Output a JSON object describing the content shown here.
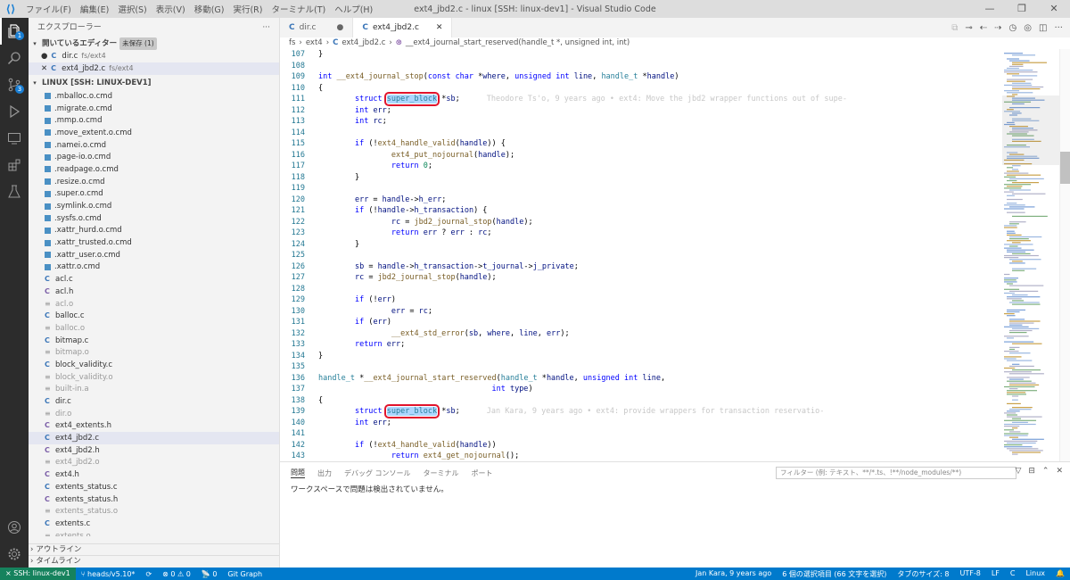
{
  "window": {
    "title": "ext4_jbd2.c - linux [SSH: linux-dev1] - Visual Studio Code",
    "menu": [
      "ファイル(F)",
      "編集(E)",
      "選択(S)",
      "表示(V)",
      "移動(G)",
      "実行(R)",
      "ターミナル(T)",
      "ヘルプ(H)"
    ],
    "controls": [
      "—",
      "❐",
      "✕"
    ]
  },
  "activity": {
    "explorer_badge": "1",
    "scm_badge": "3"
  },
  "sidebar": {
    "title": "エクスプローラー",
    "more": "···",
    "open_editors": {
      "label": "開いているエディター",
      "tag": "未保存 (1)"
    },
    "open_files": [
      {
        "mark": "●",
        "name": "dir.c",
        "path": "fs/ext4"
      },
      {
        "mark": "✕",
        "name": "ext4_jbd2.c",
        "path": "fs/ext4"
      }
    ],
    "workspace": "LINUX [SSH: LINUX-DEV1]",
    "files": [
      {
        "name": ".mballoc.o.cmd",
        "kind": "cmd"
      },
      {
        "name": ".migrate.o.cmd",
        "kind": "cmd"
      },
      {
        "name": ".mmp.o.cmd",
        "kind": "cmd"
      },
      {
        "name": ".move_extent.o.cmd",
        "kind": "cmd"
      },
      {
        "name": ".namei.o.cmd",
        "kind": "cmd"
      },
      {
        "name": ".page-io.o.cmd",
        "kind": "cmd"
      },
      {
        "name": ".readpage.o.cmd",
        "kind": "cmd"
      },
      {
        "name": ".resize.o.cmd",
        "kind": "cmd"
      },
      {
        "name": ".super.o.cmd",
        "kind": "cmd"
      },
      {
        "name": ".symlink.o.cmd",
        "kind": "cmd"
      },
      {
        "name": ".sysfs.o.cmd",
        "kind": "cmd"
      },
      {
        "name": ".xattr_hurd.o.cmd",
        "kind": "cmd"
      },
      {
        "name": ".xattr_trusted.o.cmd",
        "kind": "cmd"
      },
      {
        "name": ".xattr_user.o.cmd",
        "kind": "cmd"
      },
      {
        "name": ".xattr.o.cmd",
        "kind": "cmd"
      },
      {
        "name": "acl.c",
        "kind": "c"
      },
      {
        "name": "acl.h",
        "kind": "h"
      },
      {
        "name": "acl.o",
        "kind": "o"
      },
      {
        "name": "balloc.c",
        "kind": "c"
      },
      {
        "name": "balloc.o",
        "kind": "o"
      },
      {
        "name": "bitmap.c",
        "kind": "c"
      },
      {
        "name": "bitmap.o",
        "kind": "o"
      },
      {
        "name": "block_validity.c",
        "kind": "c"
      },
      {
        "name": "block_validity.o",
        "kind": "o"
      },
      {
        "name": "built-in.a",
        "kind": "a"
      },
      {
        "name": "dir.c",
        "kind": "c"
      },
      {
        "name": "dir.o",
        "kind": "o"
      },
      {
        "name": "ext4_extents.h",
        "kind": "h"
      },
      {
        "name": "ext4_jbd2.c",
        "kind": "c",
        "selected": true
      },
      {
        "name": "ext4_jbd2.h",
        "kind": "h"
      },
      {
        "name": "ext4_jbd2.o",
        "kind": "o"
      },
      {
        "name": "ext4.h",
        "kind": "h"
      },
      {
        "name": "extents_status.c",
        "kind": "c"
      },
      {
        "name": "extents_status.h",
        "kind": "h"
      },
      {
        "name": "extents_status.o",
        "kind": "o"
      },
      {
        "name": "extents.c",
        "kind": "c"
      },
      {
        "name": "extents.o",
        "kind": "o"
      }
    ],
    "outline": "アウトライン",
    "timeline": "タイムライン"
  },
  "tabs": [
    {
      "name": "dir.c",
      "mark": "●"
    },
    {
      "name": "ext4_jbd2.c",
      "mark": "✕"
    }
  ],
  "breadcrumb": [
    "fs",
    "ext4",
    "ext4_jbd2.c",
    "__ext4_journal_start_reserved(handle_t *, unsigned int, int)"
  ],
  "code": [
    {
      "n": "107",
      "t": "}"
    },
    {
      "n": "108",
      "t": ""
    },
    {
      "n": "109",
      "t": "int __ext4_journal_stop(const char *where, unsigned int line, handle_t *handle)"
    },
    {
      "n": "110",
      "t": "{"
    },
    {
      "n": "111",
      "pre": "        struct ",
      "hl": "super_block",
      "post": " *sb;",
      "blame": "Theodore Ts'o, 9 years ago • ext4: Move the jbd2 wrapper functions out of supe-"
    },
    {
      "n": "112",
      "t": "        int err;"
    },
    {
      "n": "113",
      "t": "        int rc;"
    },
    {
      "n": "114",
      "t": ""
    },
    {
      "n": "115",
      "t": "        if (!ext4_handle_valid(handle)) {"
    },
    {
      "n": "116",
      "t": "                ext4_put_nojournal(handle);"
    },
    {
      "n": "117",
      "t": "                return 0;"
    },
    {
      "n": "118",
      "t": "        }"
    },
    {
      "n": "119",
      "t": ""
    },
    {
      "n": "120",
      "t": "        err = handle->h_err;"
    },
    {
      "n": "121",
      "t": "        if (!handle->h_transaction) {"
    },
    {
      "n": "122",
      "t": "                rc = jbd2_journal_stop(handle);"
    },
    {
      "n": "123",
      "t": "                return err ? err : rc;"
    },
    {
      "n": "124",
      "t": "        }"
    },
    {
      "n": "125",
      "t": ""
    },
    {
      "n": "126",
      "t": "        sb = handle->h_transaction->t_journal->j_private;"
    },
    {
      "n": "127",
      "t": "        rc = jbd2_journal_stop(handle);"
    },
    {
      "n": "128",
      "t": ""
    },
    {
      "n": "129",
      "t": "        if (!err)"
    },
    {
      "n": "130",
      "t": "                err = rc;"
    },
    {
      "n": "131",
      "t": "        if (err)"
    },
    {
      "n": "132",
      "t": "                __ext4_std_error(sb, where, line, err);"
    },
    {
      "n": "133",
      "t": "        return err;"
    },
    {
      "n": "134",
      "t": "}"
    },
    {
      "n": "135",
      "t": ""
    },
    {
      "n": "136",
      "t": "handle_t *__ext4_journal_start_reserved(handle_t *handle, unsigned int line,"
    },
    {
      "n": "137",
      "t": "                                      int type)"
    },
    {
      "n": "138",
      "t": "{"
    },
    {
      "n": "139",
      "pre": "        struct ",
      "hl": "super_block",
      "post": " *sb;",
      "blame": "Jan Kara, 9 years ago • ext4: provide wrappers for transaction reservatio-"
    },
    {
      "n": "140",
      "t": "        int err;"
    },
    {
      "n": "141",
      "t": ""
    },
    {
      "n": "142",
      "t": "        if (!ext4_handle_valid(handle))"
    },
    {
      "n": "143",
      "t": "                return ext4_get_nojournal();"
    }
  ],
  "panel": {
    "tabs": [
      "問題",
      "出力",
      "デバッグ コンソール",
      "ターミナル",
      "ポート"
    ],
    "filter_placeholder": "フィルター (例: テキスト、**/*.ts、!**/node_modules/**)",
    "message": "ワークスペースで問題は検出されていません。"
  },
  "status": {
    "remote": "SSH: linux-dev1",
    "branch": "heads/v5.10*",
    "sync": "⟳",
    "problems": "⊗ 0 ⚠ 0",
    "ports": "📡 0",
    "git_graph": "Git Graph",
    "blame": "Jan Kara, 9 years ago",
    "selection": "6 個の選択項目 (66 文字を選択)",
    "tab_size": "タブのサイズ: 8",
    "encoding": "UTF-8",
    "eol": "LF",
    "lang": "C",
    "os": "Linux"
  },
  "colors": {
    "accent": "#007acc",
    "remote": "#16825d",
    "highlight_outline": "#e1142c"
  }
}
